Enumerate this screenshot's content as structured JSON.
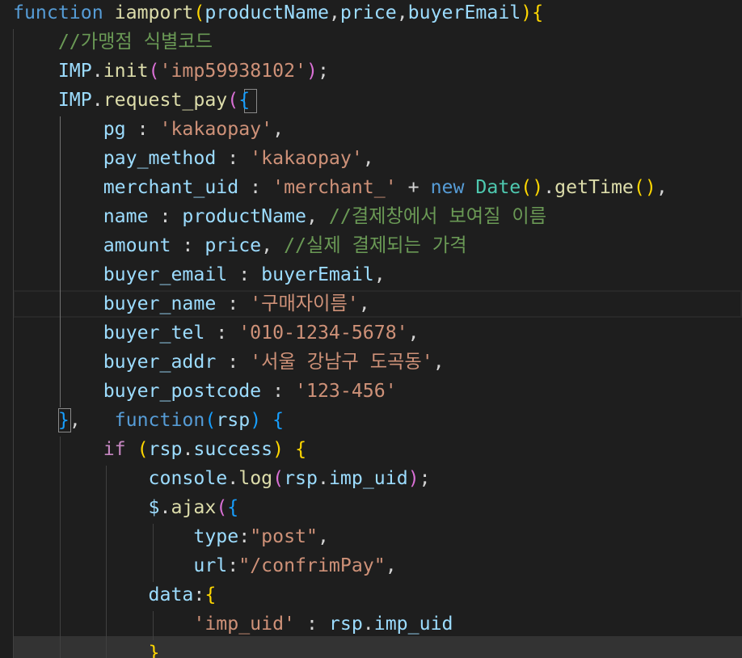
{
  "colors": {
    "background": "#1e1e1e",
    "keyword": "#569cd6",
    "control": "#c586c0",
    "function": "#dcdcaa",
    "variable": "#9cdcfe",
    "property": "#9cdcfe",
    "string": "#ce9178",
    "comment": "#6a9955",
    "class": "#4ec9b0",
    "punct": "#d4d4d4",
    "bracket1": "#ffd700",
    "bracket2": "#da70d6",
    "bracket3": "#179fff"
  },
  "editor": {
    "lines": [
      {
        "tokens": [
          {
            "t": "function",
            "c": "keyword"
          },
          {
            "t": " ",
            "c": "punct"
          },
          {
            "t": "iamport",
            "c": "function"
          },
          {
            "t": "(",
            "c": "bracket1"
          },
          {
            "t": "productName",
            "c": "variable"
          },
          {
            "t": ",",
            "c": "punct"
          },
          {
            "t": "price",
            "c": "variable"
          },
          {
            "t": ",",
            "c": "punct"
          },
          {
            "t": "buyerEmail",
            "c": "variable"
          },
          {
            "t": ")",
            "c": "bracket1"
          },
          {
            "t": "{",
            "c": "bracket1"
          }
        ]
      },
      {
        "tokens": [
          {
            "t": "    ",
            "c": "punct"
          },
          {
            "t": "//가맹점 식별코드",
            "c": "comment"
          }
        ]
      },
      {
        "tokens": [
          {
            "t": "    ",
            "c": "punct"
          },
          {
            "t": "IMP",
            "c": "variable"
          },
          {
            "t": ".",
            "c": "punct"
          },
          {
            "t": "init",
            "c": "function"
          },
          {
            "t": "(",
            "c": "bracket2"
          },
          {
            "t": "'imp59938102'",
            "c": "string"
          },
          {
            "t": ")",
            "c": "bracket2"
          },
          {
            "t": ";",
            "c": "punct"
          }
        ]
      },
      {
        "tokens": [
          {
            "t": "    ",
            "c": "punct"
          },
          {
            "t": "IMP",
            "c": "variable"
          },
          {
            "t": ".",
            "c": "punct"
          },
          {
            "t": "request_pay",
            "c": "function"
          },
          {
            "t": "(",
            "c": "bracket2"
          },
          {
            "t": "{",
            "c": "bracket3"
          }
        ]
      },
      {
        "tokens": [
          {
            "t": "        ",
            "c": "punct"
          },
          {
            "t": "pg",
            "c": "property"
          },
          {
            "t": " : ",
            "c": "punct"
          },
          {
            "t": "'kakaopay'",
            "c": "string"
          },
          {
            "t": ",",
            "c": "punct"
          }
        ]
      },
      {
        "tokens": [
          {
            "t": "        ",
            "c": "punct"
          },
          {
            "t": "pay_method",
            "c": "property"
          },
          {
            "t": " : ",
            "c": "punct"
          },
          {
            "t": "'kakaopay'",
            "c": "string"
          },
          {
            "t": ",",
            "c": "punct"
          }
        ]
      },
      {
        "tokens": [
          {
            "t": "        ",
            "c": "punct"
          },
          {
            "t": "merchant_uid",
            "c": "property"
          },
          {
            "t": " : ",
            "c": "punct"
          },
          {
            "t": "'merchant_'",
            "c": "string"
          },
          {
            "t": " + ",
            "c": "punct"
          },
          {
            "t": "new",
            "c": "keyword"
          },
          {
            "t": " ",
            "c": "punct"
          },
          {
            "t": "Date",
            "c": "class"
          },
          {
            "t": "()",
            "c": "bracket1"
          },
          {
            "t": ".",
            "c": "punct"
          },
          {
            "t": "getTime",
            "c": "function"
          },
          {
            "t": "()",
            "c": "bracket1"
          },
          {
            "t": ",",
            "c": "punct"
          }
        ]
      },
      {
        "tokens": [
          {
            "t": "        ",
            "c": "punct"
          },
          {
            "t": "name",
            "c": "property"
          },
          {
            "t": " : ",
            "c": "punct"
          },
          {
            "t": "productName",
            "c": "variable"
          },
          {
            "t": ", ",
            "c": "punct"
          },
          {
            "t": "//결제창에서 보여질 이름",
            "c": "comment"
          }
        ]
      },
      {
        "tokens": [
          {
            "t": "        ",
            "c": "punct"
          },
          {
            "t": "amount",
            "c": "property"
          },
          {
            "t": " : ",
            "c": "punct"
          },
          {
            "t": "price",
            "c": "variable"
          },
          {
            "t": ", ",
            "c": "punct"
          },
          {
            "t": "//실제 결제되는 가격",
            "c": "comment"
          }
        ]
      },
      {
        "tokens": [
          {
            "t": "        ",
            "c": "punct"
          },
          {
            "t": "buyer_email",
            "c": "property"
          },
          {
            "t": " : ",
            "c": "punct"
          },
          {
            "t": "buyerEmail",
            "c": "variable"
          },
          {
            "t": ",",
            "c": "punct"
          }
        ]
      },
      {
        "tokens": [
          {
            "t": "        ",
            "c": "punct"
          },
          {
            "t": "buyer_name",
            "c": "property"
          },
          {
            "t": " : ",
            "c": "punct"
          },
          {
            "t": "'구매자이름'",
            "c": "string"
          },
          {
            "t": ",",
            "c": "punct"
          }
        ]
      },
      {
        "tokens": [
          {
            "t": "        ",
            "c": "punct"
          },
          {
            "t": "buyer_tel",
            "c": "property"
          },
          {
            "t": " : ",
            "c": "punct"
          },
          {
            "t": "'010-1234-5678'",
            "c": "string"
          },
          {
            "t": ",",
            "c": "punct"
          }
        ]
      },
      {
        "tokens": [
          {
            "t": "        ",
            "c": "punct"
          },
          {
            "t": "buyer_addr",
            "c": "property"
          },
          {
            "t": " : ",
            "c": "punct"
          },
          {
            "t": "'서울 강남구 도곡동'",
            "c": "string"
          },
          {
            "t": ",",
            "c": "punct"
          }
        ]
      },
      {
        "tokens": [
          {
            "t": "        ",
            "c": "punct"
          },
          {
            "t": "buyer_postcode",
            "c": "property"
          },
          {
            "t": " : ",
            "c": "punct"
          },
          {
            "t": "'123-456'",
            "c": "string"
          }
        ]
      },
      {
        "tokens": [
          {
            "t": "    ",
            "c": "punct"
          },
          {
            "t": "}",
            "c": "bracket3"
          },
          {
            "t": ",   ",
            "c": "punct"
          },
          {
            "t": "function",
            "c": "keyword"
          },
          {
            "t": "(",
            "c": "bracket3"
          },
          {
            "t": "rsp",
            "c": "variable"
          },
          {
            "t": ")",
            "c": "bracket3"
          },
          {
            "t": " ",
            "c": "punct"
          },
          {
            "t": "{",
            "c": "bracket3"
          }
        ]
      },
      {
        "tokens": [
          {
            "t": "        ",
            "c": "punct"
          },
          {
            "t": "if",
            "c": "control"
          },
          {
            "t": " ",
            "c": "punct"
          },
          {
            "t": "(",
            "c": "bracket1"
          },
          {
            "t": "rsp",
            "c": "variable"
          },
          {
            "t": ".",
            "c": "punct"
          },
          {
            "t": "success",
            "c": "property"
          },
          {
            "t": ")",
            "c": "bracket1"
          },
          {
            "t": " ",
            "c": "punct"
          },
          {
            "t": "{",
            "c": "bracket1"
          }
        ]
      },
      {
        "tokens": [
          {
            "t": "            ",
            "c": "punct"
          },
          {
            "t": "console",
            "c": "variable"
          },
          {
            "t": ".",
            "c": "punct"
          },
          {
            "t": "log",
            "c": "function"
          },
          {
            "t": "(",
            "c": "bracket2"
          },
          {
            "t": "rsp",
            "c": "variable"
          },
          {
            "t": ".",
            "c": "punct"
          },
          {
            "t": "imp_uid",
            "c": "property"
          },
          {
            "t": ")",
            "c": "bracket2"
          },
          {
            "t": ";",
            "c": "punct"
          }
        ]
      },
      {
        "tokens": [
          {
            "t": "            ",
            "c": "punct"
          },
          {
            "t": "$",
            "c": "variable"
          },
          {
            "t": ".",
            "c": "punct"
          },
          {
            "t": "ajax",
            "c": "function"
          },
          {
            "t": "(",
            "c": "bracket2"
          },
          {
            "t": "{",
            "c": "bracket3"
          }
        ]
      },
      {
        "tokens": [
          {
            "t": "                ",
            "c": "punct"
          },
          {
            "t": "type",
            "c": "property"
          },
          {
            "t": ":",
            "c": "punct"
          },
          {
            "t": "\"post\"",
            "c": "string"
          },
          {
            "t": ",",
            "c": "punct"
          }
        ]
      },
      {
        "tokens": [
          {
            "t": "                ",
            "c": "punct"
          },
          {
            "t": "url",
            "c": "property"
          },
          {
            "t": ":",
            "c": "punct"
          },
          {
            "t": "\"/confrimPay\"",
            "c": "string"
          },
          {
            "t": ",",
            "c": "punct"
          }
        ]
      },
      {
        "tokens": [
          {
            "t": "            ",
            "c": "punct"
          },
          {
            "t": "data",
            "c": "property"
          },
          {
            "t": ":",
            "c": "punct"
          },
          {
            "t": "{",
            "c": "bracket1"
          }
        ]
      },
      {
        "tokens": [
          {
            "t": "                ",
            "c": "punct"
          },
          {
            "t": "'imp_uid'",
            "c": "string"
          },
          {
            "t": " : ",
            "c": "punct"
          },
          {
            "t": "rsp",
            "c": "variable"
          },
          {
            "t": ".",
            "c": "punct"
          },
          {
            "t": "imp_uid",
            "c": "property"
          }
        ]
      },
      {
        "tokens": [
          {
            "t": "            ",
            "c": "punct"
          },
          {
            "t": "}",
            "c": "bracket1"
          }
        ]
      }
    ]
  }
}
